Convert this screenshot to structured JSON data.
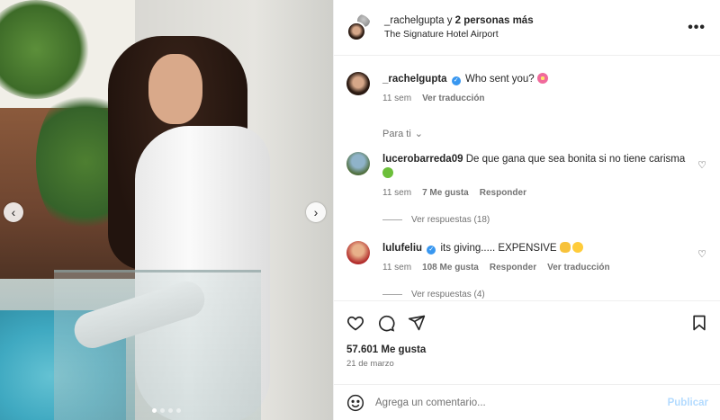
{
  "header": {
    "username": "_rachelgupta",
    "joiner": "y",
    "others": "2 personas más",
    "location": "The Signature Hotel Airport",
    "more_icon": "more-horizontal-icon",
    "more_label": "•••"
  },
  "media": {
    "prev_icon": "chevron-left-icon",
    "next_icon": "chevron-right-icon",
    "prev_glyph": "‹",
    "next_glyph": "›",
    "dots_count": 4,
    "active_dot": 1
  },
  "caption": {
    "username": "_rachelgupta",
    "text": "Who sent you?",
    "age": "11 sem",
    "translate": "Ver traducción"
  },
  "for_you": {
    "label": "Para ti",
    "chevron": "⌄"
  },
  "comments": [
    {
      "username": "lucerobarreda09",
      "text": "De que gana que sea bonita si no tiene carisma",
      "age": "11 sem",
      "likes": "7 Me gusta",
      "reply": "Responder",
      "view_replies": "Ver respuestas (18)"
    },
    {
      "username": "lulufeliu",
      "text": "its giving..... EXPENSIVE",
      "age": "11 sem",
      "likes": "108 Me gusta",
      "reply": "Responder",
      "translate": "Ver traducción",
      "view_replies": "Ver respuestas (4)"
    }
  ],
  "actions": {
    "like_icon": "heart-icon",
    "comment_icon": "comment-icon",
    "share_icon": "send-icon",
    "save_icon": "bookmark-icon",
    "likes_count": "57.601 Me gusta",
    "date": "21 de marzo"
  },
  "add_comment": {
    "placeholder": "Agrega un comentario...",
    "post_label": "Publicar",
    "emoji_icon": "smile-icon"
  },
  "colors": {
    "link_blue": "#3897f0",
    "muted": "#737373",
    "publish_disabled": "#b3dbff"
  }
}
